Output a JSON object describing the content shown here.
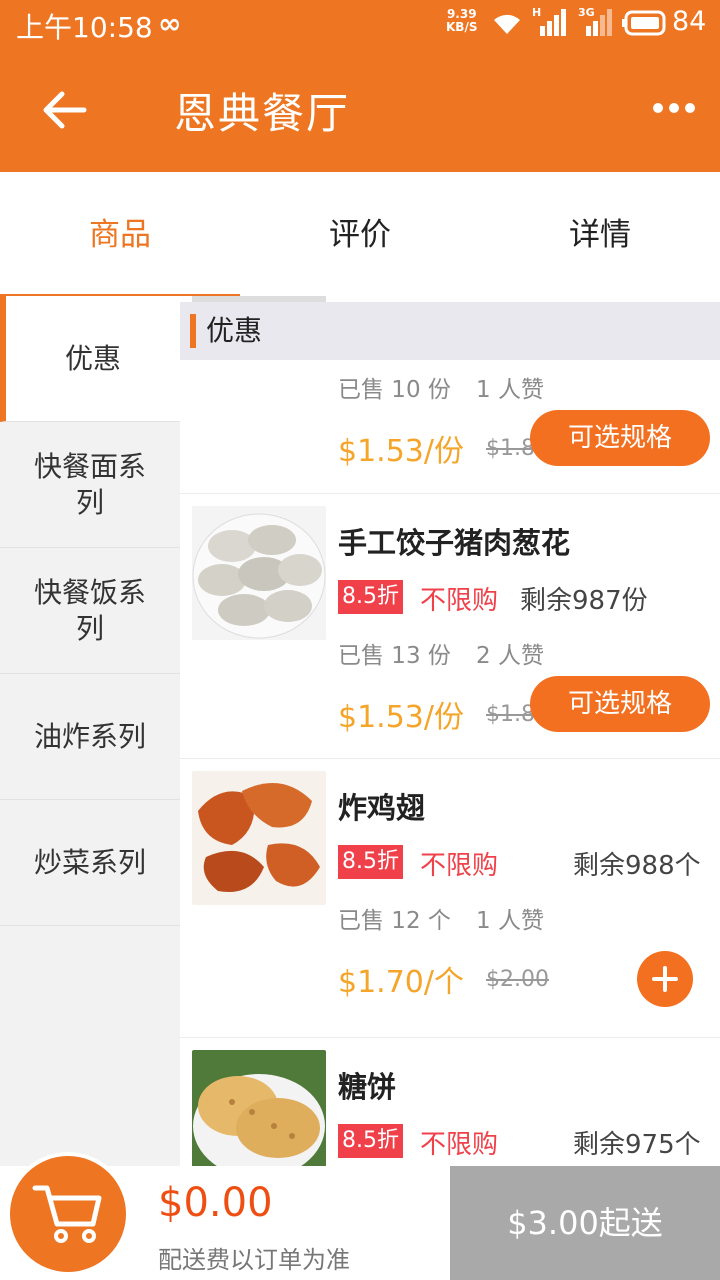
{
  "status_bar": {
    "time": "上午10:58",
    "infinity_icon": "∞",
    "speed_value": "9.39",
    "speed_unit": "KB/S",
    "network1": "H",
    "network2": "3G",
    "battery": "84"
  },
  "header": {
    "title": "恩典餐厅",
    "back_icon": "arrow-left",
    "more_icon": "ellipsis"
  },
  "tabs": [
    {
      "label": "商品",
      "active": true
    },
    {
      "label": "评价",
      "active": false
    },
    {
      "label": "详情",
      "active": false
    }
  ],
  "sidebar": {
    "categories": [
      {
        "label": "优惠",
        "active": true
      },
      {
        "label": "快餐面系列",
        "active": false
      },
      {
        "label": "快餐饭系列",
        "active": false
      },
      {
        "label": "油炸系列",
        "active": false
      },
      {
        "label": "炒菜系列",
        "active": false
      }
    ]
  },
  "section": {
    "title": "优惠"
  },
  "items": [
    {
      "name": "",
      "sold": "已售 10 份",
      "likes": "1 人赞",
      "price": "$1.53/份",
      "original_price": "$1.8",
      "action_label": "可选规格"
    },
    {
      "name": "手工饺子猪肉葱花",
      "discount": "8.5折",
      "limit": "不限购",
      "stock": "剩余987份",
      "sold": "已售 13 份",
      "likes": "2 人赞",
      "price": "$1.53/份",
      "original_price": "$1.8",
      "action_label": "可选规格"
    },
    {
      "name": "炸鸡翅",
      "discount": "8.5折",
      "limit": "不限购",
      "stock": "剩余988个",
      "sold": "已售 12 个",
      "likes": "1 人赞",
      "price": "$1.70/个",
      "original_price": "$2.00",
      "action_icon": "plus"
    },
    {
      "name": "糖饼",
      "discount": "8.5折",
      "limit": "不限购",
      "stock": "剩余975个"
    }
  ],
  "cart": {
    "total": "$0.00",
    "note": "配送费以订单为准",
    "checkout_label": "$3.00起送",
    "icon": "cart"
  },
  "colors": {
    "brand": "#ee7521",
    "button": "#f37021",
    "price": "#f5a52a",
    "discount": "#f0414a",
    "checkout_disabled": "#a9a9a9"
  }
}
